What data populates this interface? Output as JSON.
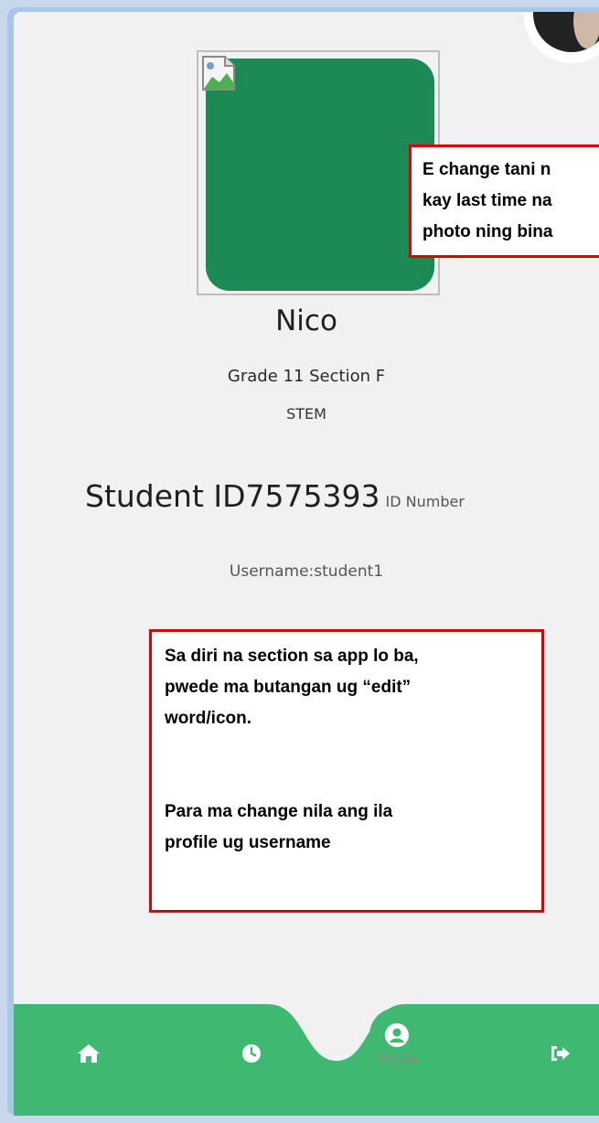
{
  "profile": {
    "name": "Nico",
    "grade_section": "Grade 11 Section F",
    "strand": "STEM",
    "student_id": "Student ID7575393",
    "id_caption": "ID Number",
    "username": "Username:student1"
  },
  "annotations": {
    "photo_note": [
      "E change tani n",
      "kay last time na",
      "photo ning bina"
    ],
    "edit_note": {
      "line1": "Sa diri na section sa app lo ba,",
      "line2": "pwede ma butangan ug “edit”",
      "line3": "word/icon.",
      "line4": "Para ma change nila ang ila",
      "line5": "profile ug username"
    }
  },
  "nav": {
    "items": [
      {
        "icon": "home-icon"
      },
      {
        "icon": "clock-icon"
      },
      {
        "icon": "user-circle-icon",
        "label": "Profile",
        "active": true
      },
      {
        "icon": "logout-icon"
      }
    ]
  },
  "colors": {
    "accent": "#3fb872",
    "photo": "#1d8a56",
    "annotation_border": "#e00000"
  }
}
